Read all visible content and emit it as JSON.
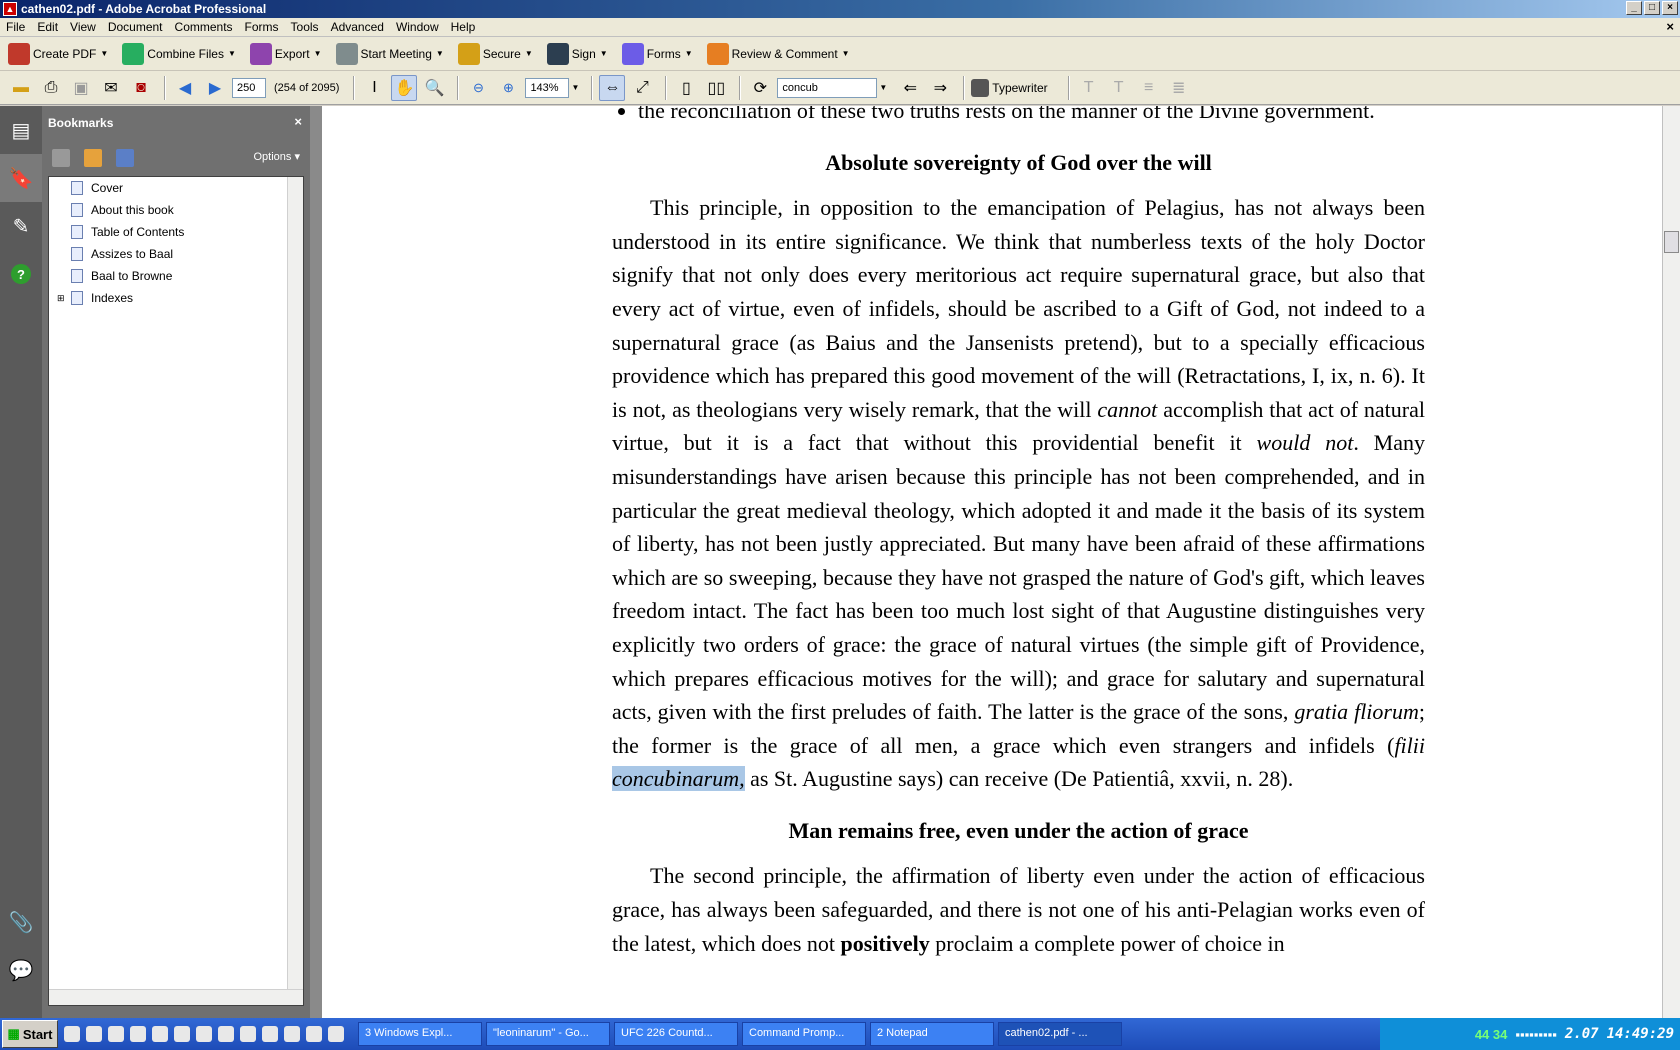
{
  "window": {
    "title": "cathen02.pdf - Adobe Acrobat Professional"
  },
  "menu": [
    "File",
    "Edit",
    "View",
    "Document",
    "Comments",
    "Forms",
    "Tools",
    "Advanced",
    "Window",
    "Help"
  ],
  "tasks": [
    {
      "label": "Create PDF",
      "icon": "create-pdf-icon",
      "color": "#c0392b"
    },
    {
      "label": "Combine Files",
      "icon": "combine-files-icon",
      "color": "#27ae60"
    },
    {
      "label": "Export",
      "icon": "export-icon",
      "color": "#8e44ad"
    },
    {
      "label": "Start Meeting",
      "icon": "meeting-icon",
      "color": "#7f8c8d"
    },
    {
      "label": "Secure",
      "icon": "lock-icon",
      "color": "#d4a017"
    },
    {
      "label": "Sign",
      "icon": "pen-icon",
      "color": "#2c3e50"
    },
    {
      "label": "Forms",
      "icon": "forms-icon",
      "color": "#6c5ce7"
    },
    {
      "label": "Review & Comment",
      "icon": "comment-icon",
      "color": "#e67e22"
    }
  ],
  "nav": {
    "page_number": "250",
    "page_info": "(254 of 2095)",
    "zoom": "143%",
    "search_text": "concub",
    "typewriter": "Typewriter"
  },
  "bookmarks": {
    "title": "Bookmarks",
    "options": "Options",
    "items": [
      {
        "label": "Cover",
        "expandable": false
      },
      {
        "label": "About this book",
        "expandable": false
      },
      {
        "label": "Table of Contents",
        "expandable": false
      },
      {
        "label": "Assizes to Baal",
        "expandable": false
      },
      {
        "label": "Baal to Browne",
        "expandable": false
      },
      {
        "label": "Indexes",
        "expandable": true
      }
    ]
  },
  "document": {
    "bullet": "the reconciliation of these two truths rests on the manner of the Divine government.",
    "heading1": "Absolute sovereignty of God over the will",
    "para1": {
      "a": "This principle, in opposition to the emancipation of Pelagius, has not always been understood in its entire significance. We think that numberless texts of the holy Doctor signify that not only does every meritorious act require supernatural grace, but also that every act of virtue, even of infidels, should be ascribed to a Gift of God, not indeed to a supernatural grace (as Baius and the Jansenists pretend), but to a specially efficacious providence which has prepared this good movement of the will (Retractations, I, ix, n. 6). It is not, as theologians very wisely remark, that the will ",
      "em1": "cannot",
      "b": " accomplish that act of natural virtue, but it is a fact that without this providential benefit it ",
      "em2": "would not",
      "c": ". Many misunderstandings have arisen because this principle has not been comprehended, and in particular the great medieval theology, which adopted it and made it the basis of its system of liberty, has not been justly appreciated. But many have been afraid of these affirmations which are so sweeping, because they have not grasped the nature of God's gift, which leaves freedom intact. The fact has been too much lost sight of that Augustine distinguishes very explicitly two orders of grace: the grace of natural virtues (the simple gift of Providence, which prepares efficacious motives for the will); and grace for salutary and supernatural acts, given with the first preludes of faith. The latter is the grace of the sons, ",
      "em3": "gratia fliorum",
      "d": "; the former is the grace of all men, a grace which even strangers and infidels (",
      "em4": "filii",
      "hl": "concubinarum,",
      "e": " as St. Augustine says) can receive (De Patientiâ, xxvii, n. 28)."
    },
    "heading2": "Man remains free, even under the action of grace",
    "para2": {
      "a": "The second principle, the affirmation of liberty even under the action of efficacious grace, has always been safeguarded, and there is not one of his anti-Pelagian works even of the latest, which does not ",
      "strong": "positively",
      "b": " proclaim a complete power of choice in"
    }
  },
  "taskbar": {
    "start": "Start",
    "buttons": [
      {
        "label": "3 Windows Expl...",
        "active": false
      },
      {
        "label": "\"leoninarum\" - Go...",
        "active": false
      },
      {
        "label": "UFC 226 Countd...",
        "active": false
      },
      {
        "label": "Command Promp...",
        "active": false
      },
      {
        "label": "2 Notepad",
        "active": false
      },
      {
        "label": "cathen02.pdf - ...",
        "active": true
      }
    ],
    "tray_temp": "44 34",
    "tray_value": "2.07",
    "clock": "14:49:29"
  }
}
